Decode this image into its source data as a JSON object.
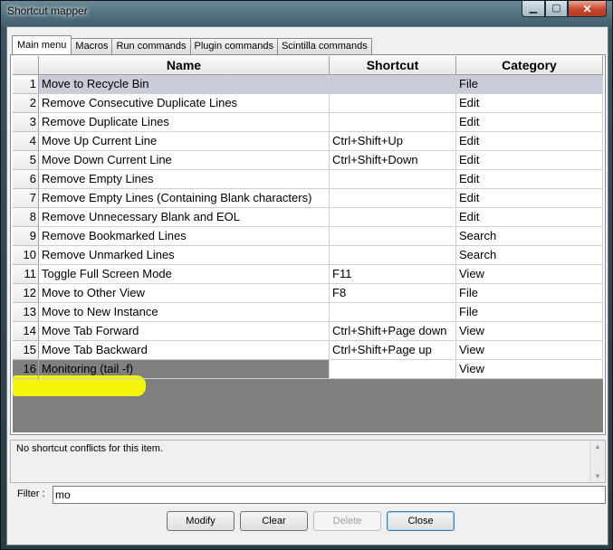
{
  "window": {
    "title": "Shortcut mapper",
    "icons": [
      "minimize-icon",
      "maximize-icon",
      "close-icon"
    ]
  },
  "tabs": [
    {
      "label": "Main menu",
      "active": true
    },
    {
      "label": "Macros",
      "active": false
    },
    {
      "label": "Run commands",
      "active": false
    },
    {
      "label": "Plugin commands",
      "active": false
    },
    {
      "label": "Scintilla commands",
      "active": false
    }
  ],
  "grid": {
    "headers": {
      "name": "Name",
      "shortcut": "Shortcut",
      "category": "Category"
    },
    "rows": [
      {
        "num": "1",
        "name": "Move to Recycle Bin",
        "shortcut": "",
        "category": "File"
      },
      {
        "num": "2",
        "name": "Remove Consecutive Duplicate Lines",
        "shortcut": "",
        "category": "Edit"
      },
      {
        "num": "3",
        "name": "Remove Duplicate Lines",
        "shortcut": "",
        "category": "Edit"
      },
      {
        "num": "4",
        "name": "Move Up Current Line",
        "shortcut": "Ctrl+Shift+Up",
        "category": "Edit"
      },
      {
        "num": "5",
        "name": "Move Down Current Line",
        "shortcut": "Ctrl+Shift+Down",
        "category": "Edit"
      },
      {
        "num": "6",
        "name": "Remove Empty Lines",
        "shortcut": "",
        "category": "Edit"
      },
      {
        "num": "7",
        "name": "Remove Empty Lines (Containing Blank characters)",
        "shortcut": "",
        "category": "Edit"
      },
      {
        "num": "8",
        "name": "Remove Unnecessary Blank and EOL",
        "shortcut": "",
        "category": "Edit"
      },
      {
        "num": "9",
        "name": "Remove Bookmarked Lines",
        "shortcut": "",
        "category": "Search"
      },
      {
        "num": "10",
        "name": "Remove Unmarked Lines",
        "shortcut": "",
        "category": "Search"
      },
      {
        "num": "11",
        "name": "Toggle Full Screen Mode",
        "shortcut": "F11",
        "category": "View"
      },
      {
        "num": "12",
        "name": "Move to Other View",
        "shortcut": "F8",
        "category": "File"
      },
      {
        "num": "13",
        "name": "Move to New Instance",
        "shortcut": "",
        "category": "File"
      },
      {
        "num": "14",
        "name": "Move Tab Forward",
        "shortcut": "Ctrl+Shift+Page down",
        "category": "View"
      },
      {
        "num": "15",
        "name": "Move Tab Backward",
        "shortcut": "Ctrl+Shift+Page up",
        "category": "View"
      },
      {
        "num": "16",
        "name": "Monitoring (tail -f)",
        "shortcut": "",
        "category": "View"
      }
    ]
  },
  "conflicts": {
    "text": "No shortcut conflicts for this item."
  },
  "filter": {
    "label": "Filter :",
    "value": "mo"
  },
  "buttons": {
    "modify": "Modify",
    "clear": "Clear",
    "delete": "Delete",
    "close": "Close"
  },
  "colors": {
    "selected_row": "#c9cbd8",
    "highlight": "#f5f50a"
  }
}
